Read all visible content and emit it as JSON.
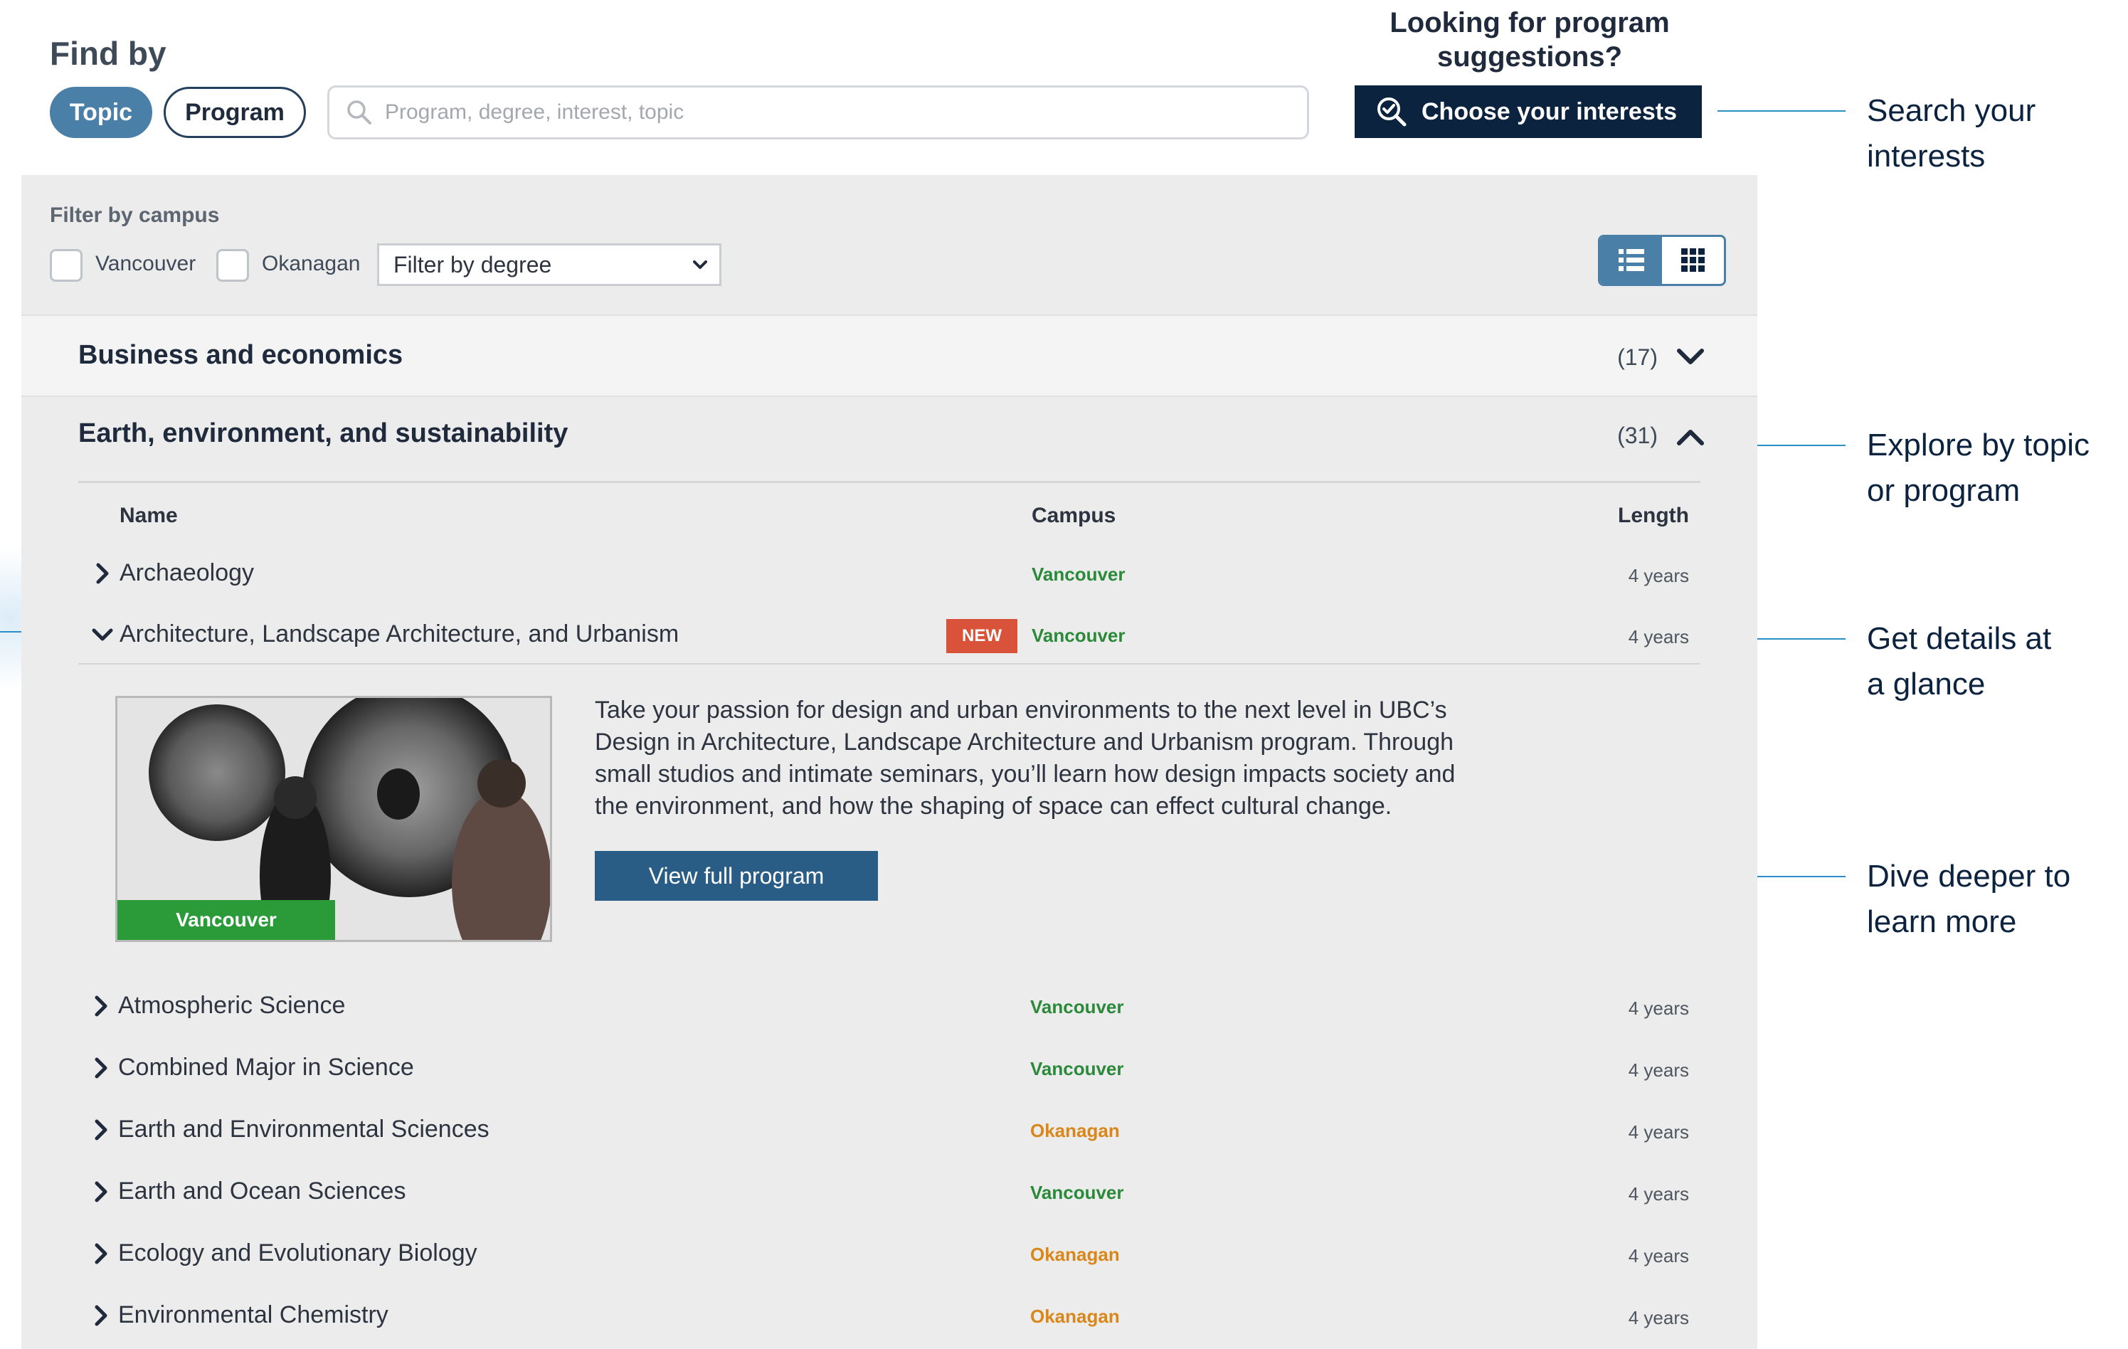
{
  "header": {
    "find_by": "Find by",
    "topic_label": "Topic",
    "program_label": "Program",
    "search_placeholder": "Program, degree, interest, topic",
    "looking_line1": "Looking for program",
    "looking_line2": "suggestions?",
    "choose_label": "Choose your interests"
  },
  "annotations": [
    {
      "line1": "Search your",
      "line2": "interests"
    },
    {
      "line1": "Explore by topic",
      "line2": "or program"
    },
    {
      "line1": "Get details at",
      "line2": "a glance"
    },
    {
      "line1": "Dive deeper to",
      "line2": "learn more"
    }
  ],
  "filters": {
    "label": "Filter by campus",
    "vancouver": "Vancouver",
    "okanagan": "Okanagan",
    "degree_selected": "Filter by degree"
  },
  "categories": [
    {
      "title": "Business and economics",
      "count": "(17)",
      "expanded": false
    },
    {
      "title": "Earth, environment, and sustainability",
      "count": "(31)",
      "expanded": true
    }
  ],
  "columns": {
    "name": "Name",
    "campus": "Campus",
    "length": "Length"
  },
  "programs": [
    {
      "name": "Archaeology",
      "campus": "Vancouver",
      "length": "4 years"
    },
    {
      "name": "Architecture, Landscape Architecture, and Urbanism",
      "badge": "NEW",
      "campus": "Vancouver",
      "length": "4 years"
    },
    {
      "name": "Atmospheric Science",
      "campus": "Vancouver",
      "length": "4 years"
    },
    {
      "name": "Combined Major in Science",
      "campus": "Vancouver",
      "length": "4 years"
    },
    {
      "name": "Earth and Environmental Sciences",
      "campus": "Okanagan",
      "length": "4 years"
    },
    {
      "name": "Earth and Ocean Sciences",
      "campus": "Vancouver",
      "length": "4 years"
    },
    {
      "name": "Ecology and Evolutionary Biology",
      "campus": "Okanagan",
      "length": "4 years"
    },
    {
      "name": "Environmental Chemistry",
      "campus": "Okanagan",
      "length": "4 years"
    }
  ],
  "detail": {
    "line1": "Take your passion for design and urban environments to the next level in UBC’s",
    "line2": "Design in Architecture, Landscape Architecture and Urbanism program. Through",
    "line3": "small studios and intimate seminars, you’ll learn how design impacts society and",
    "line4": "the environment, and how the shaping of space can effect cultural change.",
    "photo_campus": "Vancouver",
    "view_label": "View full program"
  },
  "colors": {
    "navy": "#0c2340",
    "accent_blue": "#4a7fa8",
    "vancouver_green": "#2a8a3a",
    "okanagan_orange": "#d9861a",
    "new_badge": "#d9533b",
    "annotation_line": "#2a8fc9"
  }
}
